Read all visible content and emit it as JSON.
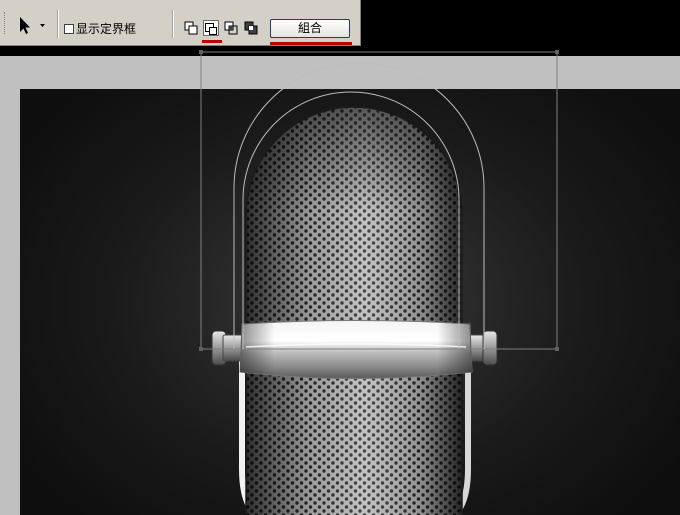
{
  "toolbar": {
    "tool_icon": "path-selection-arrow-icon",
    "show_bounding_box_label": "显示定界框",
    "show_bounding_box_checked": false,
    "modes": [
      {
        "name": "add-to-shape-area-icon",
        "active": false
      },
      {
        "name": "subtract-from-shape-area-icon",
        "active": true
      },
      {
        "name": "intersect-shape-areas-icon",
        "active": false
      },
      {
        "name": "exclude-overlapping-shape-areas-icon",
        "active": false
      }
    ],
    "combine_label": "組合"
  },
  "colors": {
    "toolbar_bg": "#d4d0c8",
    "highlight_underline": "#c00000",
    "workspace_bg": "#c0c0c0",
    "canvas_bg": "#1a1a1a"
  },
  "canvas": {
    "content": "microphone-illustration"
  }
}
